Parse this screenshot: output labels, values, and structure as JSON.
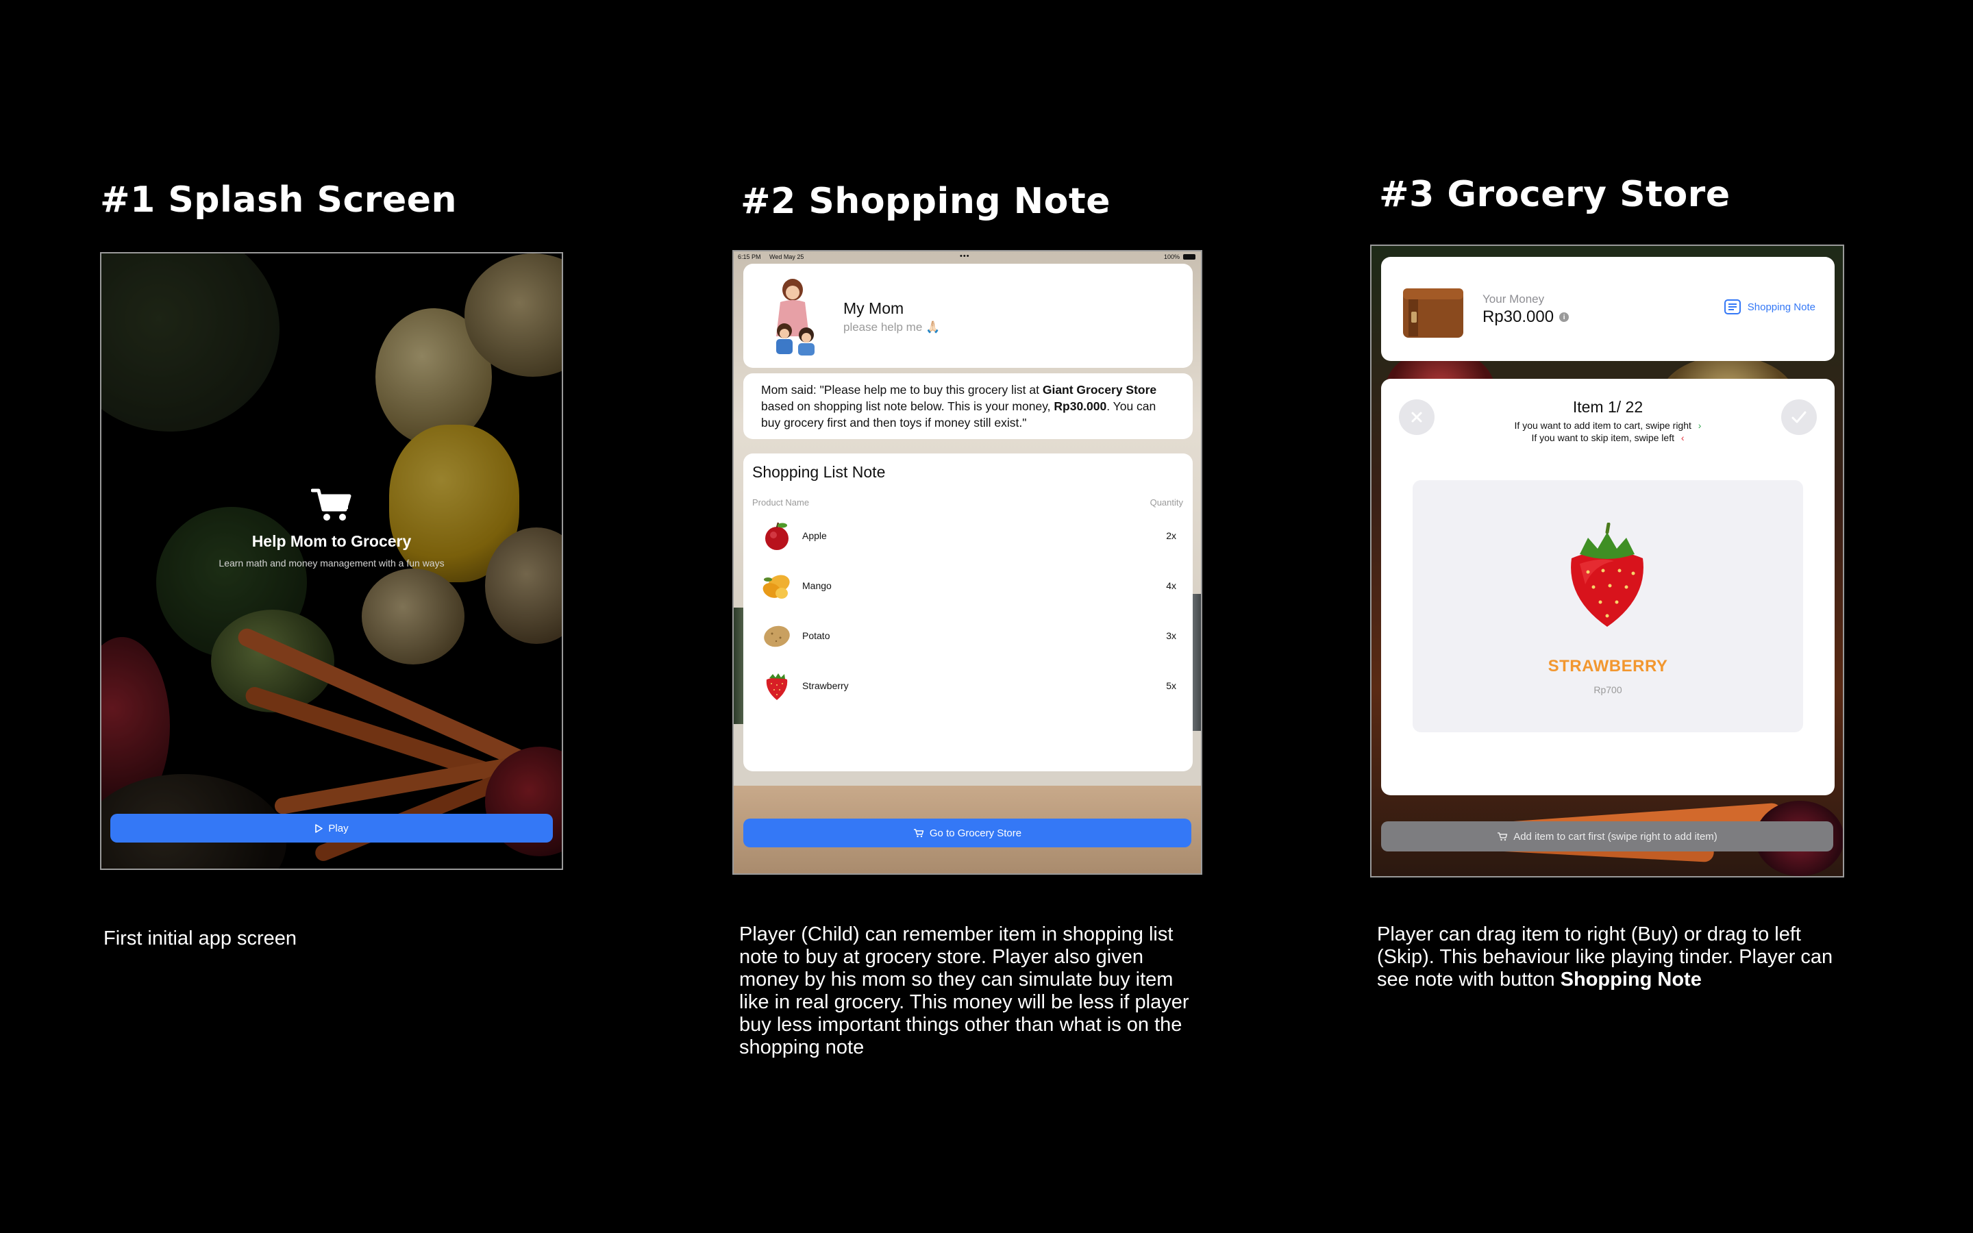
{
  "sections": [
    {
      "heading": "#1 Splash Screen",
      "description": "First initial app screen"
    },
    {
      "heading": "#2 Shopping Note",
      "description": "Player (Child) can remember item in shopping list note to buy at grocery store. Player also given money by his mom so they can simulate buy item like in real grocery. This money will be less if player buy less important things other than what is on the shopping note"
    },
    {
      "heading": "#3 Grocery Store",
      "description_pre": "Player can drag item to right (Buy) or drag to left (Skip). This behaviour like playing tinder. Player can see note with button ",
      "description_bold": "Shopping Note"
    }
  ],
  "splash": {
    "icon": "cart-icon",
    "title": "Help Mom to Grocery",
    "subtitle": "Learn math and money management with a fun ways",
    "play_label": "Play"
  },
  "shopping_note": {
    "status_time": "6:15 PM",
    "status_date": "Wed May 25",
    "status_battery": "100%",
    "mom_name": "My Mom",
    "mom_subtitle": "please help me 🙏🏻",
    "message_pre": "Mom said: \"Please help me to buy this grocery list at ",
    "message_store": "Giant Grocery Store",
    "message_mid": " based on shopping list note below. This is your money, ",
    "message_money": "Rp30.000",
    "message_post": ". You can buy grocery first and then toys if money still exist.\"",
    "note_title": "Shopping List Note",
    "col_product": "Product Name",
    "col_quantity": "Quantity",
    "items": [
      {
        "name": "Apple",
        "qty": "2x",
        "icon": "apple-icon"
      },
      {
        "name": "Mango",
        "qty": "4x",
        "icon": "mango-icon"
      },
      {
        "name": "Potato",
        "qty": "3x",
        "icon": "potato-icon"
      },
      {
        "name": "Strawberry",
        "qty": "5x",
        "icon": "strawberry-icon"
      }
    ],
    "go_label": "Go to Grocery Store"
  },
  "grocery_store": {
    "money_label": "Your Money",
    "money_value": "Rp30.000",
    "info_glyph": "i",
    "note_button": "Shopping Note",
    "item_title": "Item 1/ 22",
    "hint_add": "If you want to add item to cart, swipe right",
    "hint_skip": "If you want to skip item, swipe left",
    "product_name": "STRAWBERRY",
    "product_price": "Rp700",
    "add_label": "Add item to cart first (swipe right to add item)",
    "colors": {
      "accent": "#3478f6",
      "product_name": "#f2972f",
      "disabled": "#7d7d80"
    }
  }
}
